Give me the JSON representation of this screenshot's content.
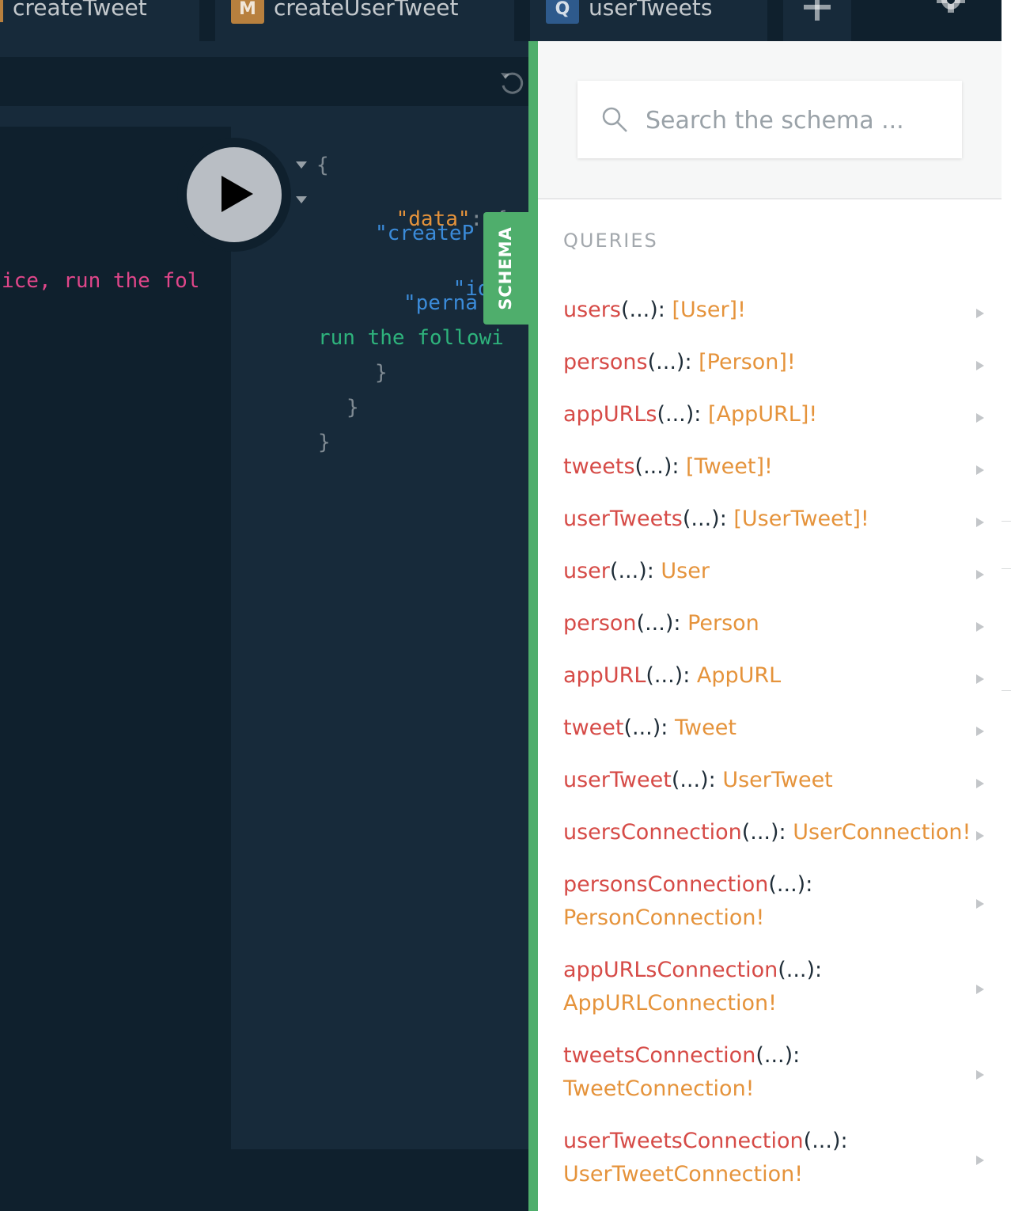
{
  "tabs": [
    {
      "badge": "",
      "label": "createTweet"
    },
    {
      "badge": "M",
      "label": "createUserTweet"
    },
    {
      "badge": "Q",
      "label": "userTweets"
    }
  ],
  "query_editor": {
    "visible_line": "ice, run the fol"
  },
  "result_editor": {
    "lines": {
      "l1": "{",
      "l2_key": "\"data\"",
      "l2_rest": ": {",
      "l3_key": "\"createP",
      "l4_key": "\"id\"",
      "l4_rest": ":",
      "l5_key": "\"perna",
      "l6_str": "run the followi",
      "l7": "}",
      "l8": "}",
      "l9": "}"
    }
  },
  "schema_tab_label": "SCHEMA",
  "schema_panel": {
    "search_placeholder": "Search the schema ...",
    "section_title": "QUERIES",
    "queries": [
      {
        "name": "users",
        "args": "(...): ",
        "type": "[User]!"
      },
      {
        "name": "persons",
        "args": "(...): ",
        "type": "[Person]!"
      },
      {
        "name": "appURLs",
        "args": "(...): ",
        "type": "[AppURL]!"
      },
      {
        "name": "tweets",
        "args": "(...): ",
        "type": "[Tweet]!"
      },
      {
        "name": "userTweets",
        "args": "(...): ",
        "type": "[UserTweet]!"
      },
      {
        "name": "user",
        "args": "(...): ",
        "type": "User"
      },
      {
        "name": "person",
        "args": "(...): ",
        "type": "Person"
      },
      {
        "name": "appURL",
        "args": "(...): ",
        "type": "AppURL"
      },
      {
        "name": "tweet",
        "args": "(...): ",
        "type": "Tweet"
      },
      {
        "name": "userTweet",
        "args": "(...): ",
        "type": "UserTweet"
      },
      {
        "name": "usersConnection",
        "args": "(...): ",
        "type": "UserConnection!"
      },
      {
        "name": "personsConnection",
        "args": "(...): ",
        "type": "PersonConnection!"
      },
      {
        "name": "appURLsConnection",
        "args": "(...): ",
        "type": "AppURLConnection!"
      },
      {
        "name": "tweetsConnection",
        "args": "(...): ",
        "type": "TweetConnection!"
      },
      {
        "name": "userTweetsConnection",
        "args": "(...): ",
        "type": "UserTweetConnection!"
      }
    ]
  },
  "icons": {
    "play": "play-icon",
    "add_tab": "plus-icon",
    "settings": "gear-icon",
    "reload": "reload-icon",
    "search": "search-icon",
    "expand": "chevron-right-icon"
  },
  "colors": {
    "accent_green": "#4fae6c",
    "field_name": "#d64b47",
    "field_type": "#e5933b",
    "dark_bg": "#0f202d",
    "editor_bg": "#172a3a"
  }
}
